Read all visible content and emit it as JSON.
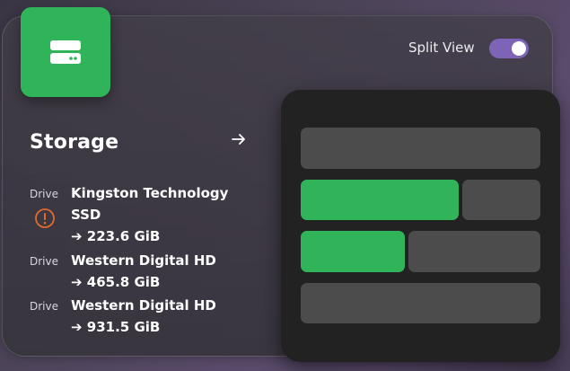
{
  "header": {
    "app_icon": "storage-drive-icon",
    "split_view": {
      "label": "Split View",
      "enabled": true
    }
  },
  "storage": {
    "title": "Storage",
    "open_icon": "arrow-right-icon",
    "drives": [
      {
        "tag": "Drive",
        "name_line1": "Kingston Technology",
        "name_line2": "SSD",
        "size": "➔ 223.6 GiB",
        "warning": true,
        "warning_icon": "warning-icon"
      },
      {
        "tag": "Drive",
        "name_line1": "Western Digital HD",
        "size": "➔ 465.8 GiB",
        "warning": false
      },
      {
        "tag": "Drive",
        "name_line1": "Western Digital HD",
        "size": "➔ 931.5 GiB",
        "warning": false
      }
    ]
  },
  "colors": {
    "accent_green": "#30b45a",
    "toggle_purple": "#7d64b6",
    "pane_gray": "#4c4c4c",
    "warning_orange": "#e06a2e"
  }
}
